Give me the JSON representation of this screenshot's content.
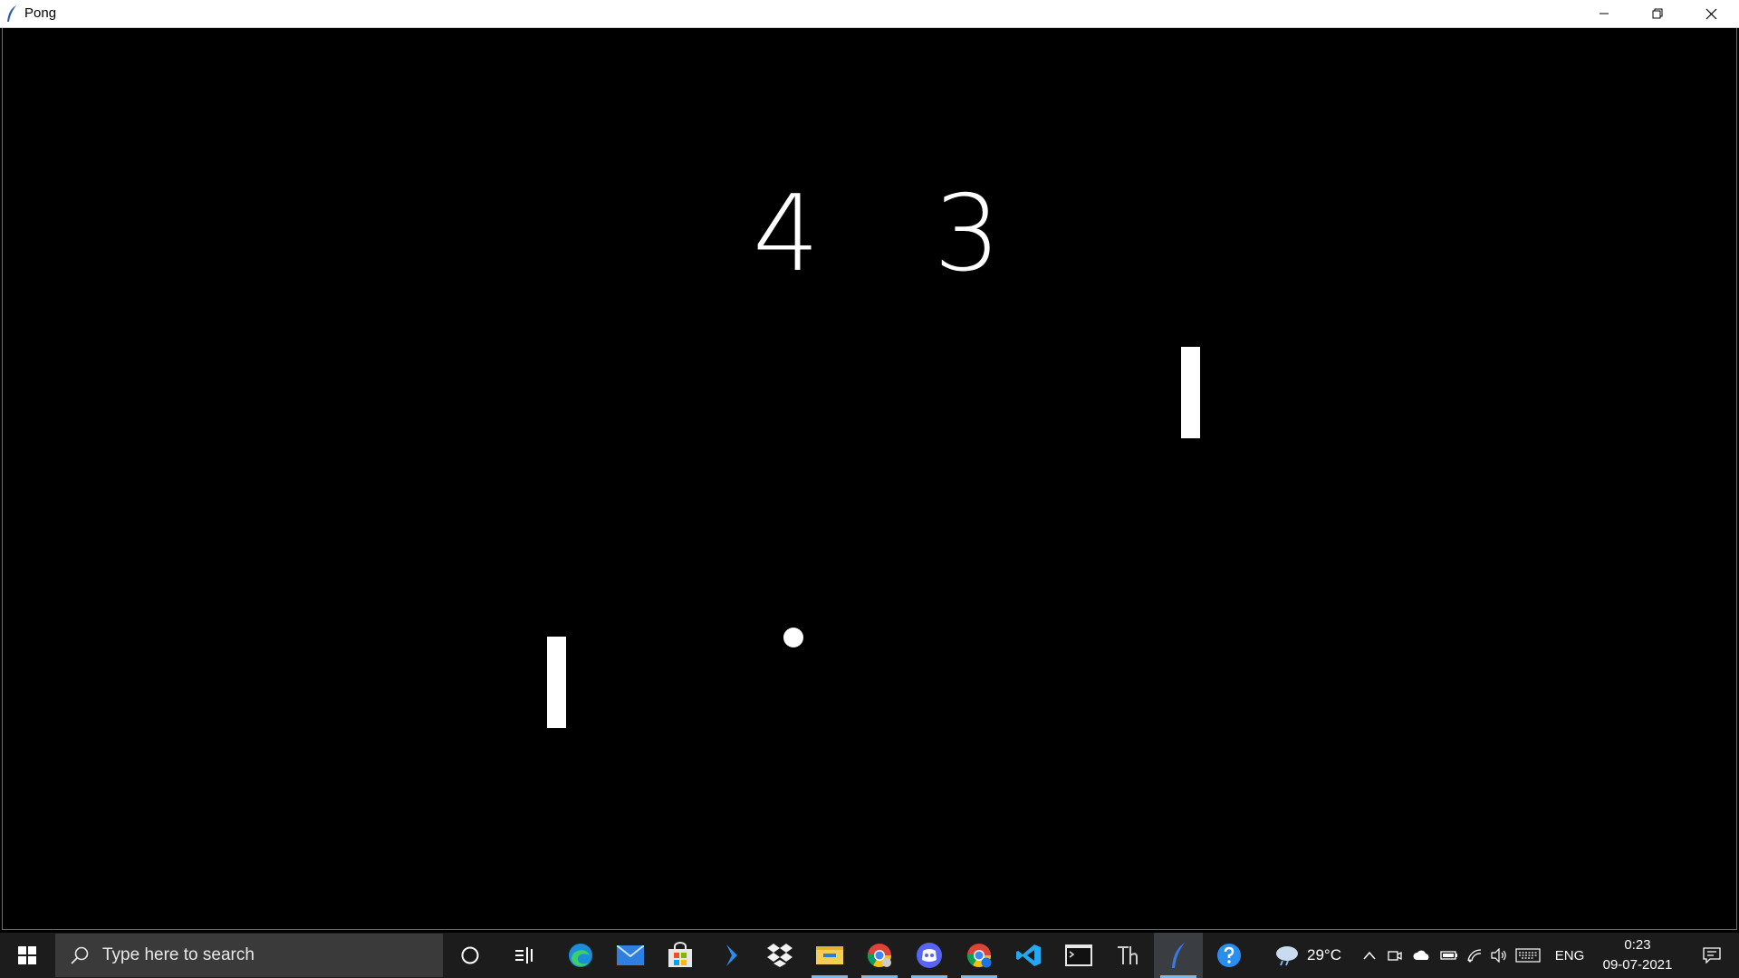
{
  "window": {
    "title": "Pong",
    "controls": {
      "minimize": "minimize",
      "restore": "restore",
      "close": "close"
    }
  },
  "game": {
    "score_left": "4",
    "score_right": "3"
  },
  "taskbar": {
    "search_placeholder": "Type here to search",
    "apps": [
      "cortana-icon",
      "task-view-icon",
      "edge-icon",
      "mail-icon",
      "store-icon",
      "visual-studio-icon",
      "dropbox-icon",
      "file-explorer-icon",
      "chrome-icon",
      "discord-icon",
      "chrome-profile-icon",
      "vscode-icon",
      "terminal-icon",
      "typora-icon",
      "python-feather-icon"
    ],
    "weather": "29°C",
    "language": "ENG",
    "time": "0:23",
    "date": "09-07-2021"
  },
  "colors": {
    "game_bg": "#000000",
    "taskbar_bg": "#1c1c1c",
    "accent": "#76b9ed"
  }
}
